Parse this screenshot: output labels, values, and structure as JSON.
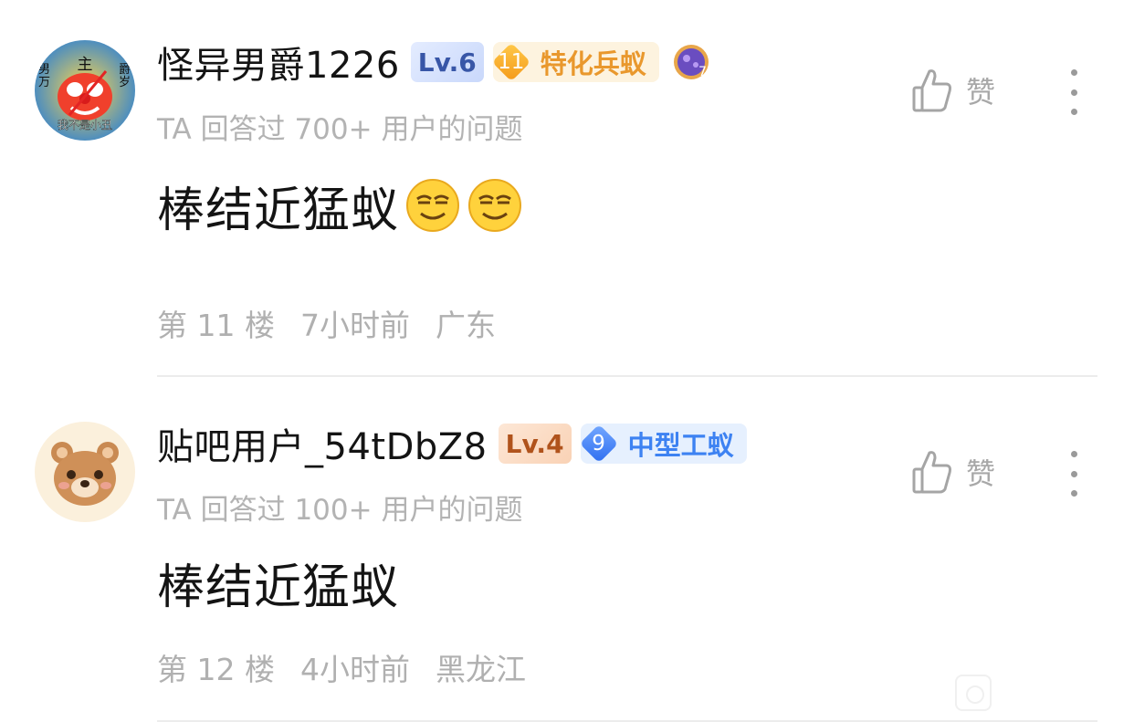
{
  "posts": [
    {
      "username": "怪异男爵1226",
      "level": "Lv.6",
      "title_badge_number": "11",
      "title_badge_label": "特化兵蚁",
      "subtitle": "TA 回答过 700+ 用户的问题",
      "content": "棒结近猛蚁",
      "floor": "第 11 楼",
      "time": "7小时前",
      "location": "广东",
      "like_label": "赞",
      "avatar_text": {
        "top": "主",
        "left": "男\n万",
        "right": "爵\n岁",
        "bottom": "我不是小丑"
      },
      "colors": {
        "level_badge": "#3856a7",
        "title_badge": "#e9982d"
      }
    },
    {
      "username": "贴吧用户_54tDbZ8",
      "level": "Lv.4",
      "title_badge_number": "9",
      "title_badge_label": "中型工蚁",
      "subtitle": "TA 回答过 100+ 用户的问题",
      "content": "棒结近猛蚁",
      "floor": "第 12 楼",
      "time": "4小时前",
      "location": "黑龙江",
      "like_label": "赞",
      "colors": {
        "level_badge": "#b0531c",
        "title_badge": "#3d82f2"
      }
    }
  ],
  "icons": {
    "like": "thumbs-up-icon",
    "more": "more-vertical-icon",
    "emoji": "smirk-emoji-icon"
  }
}
